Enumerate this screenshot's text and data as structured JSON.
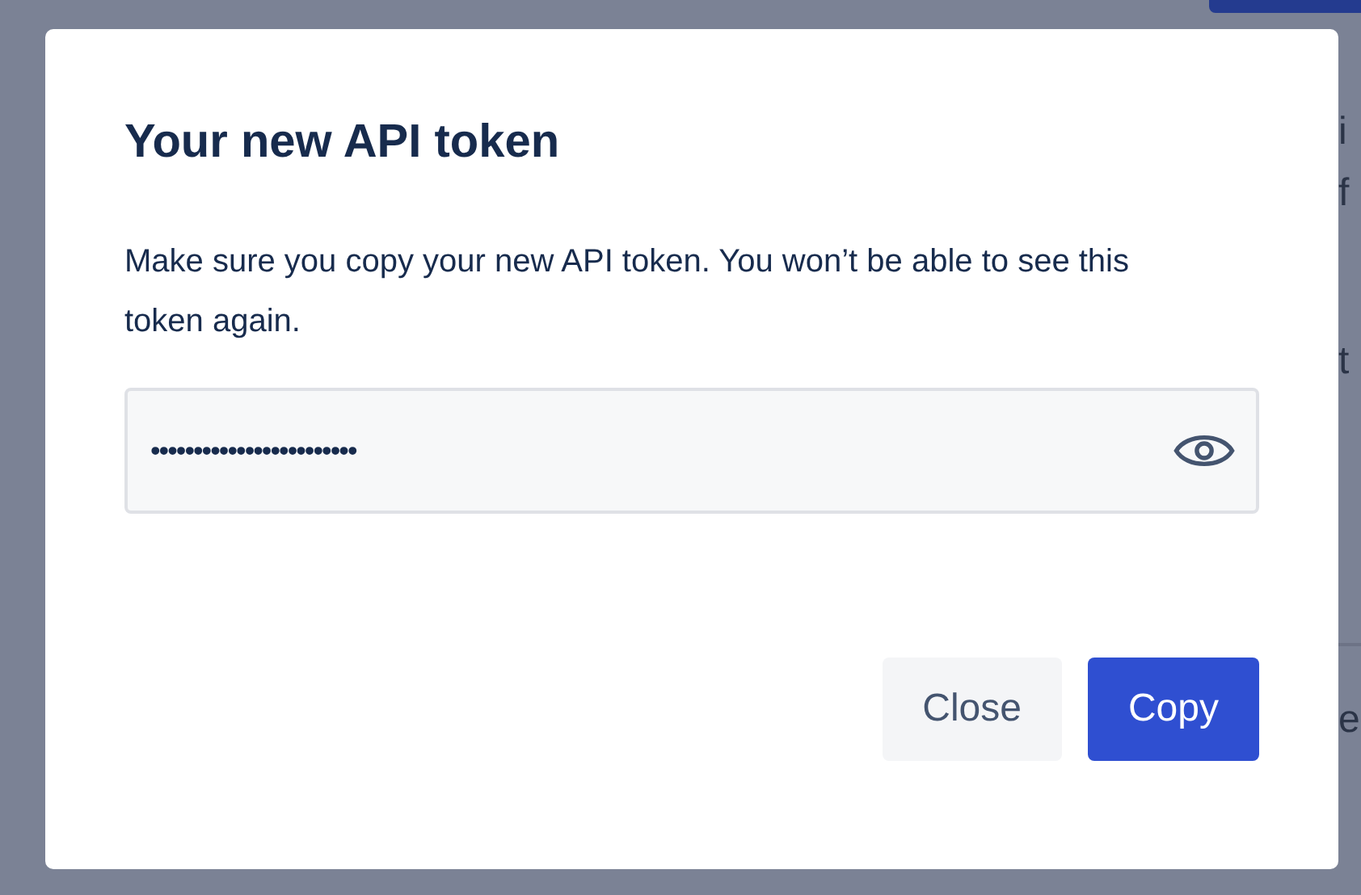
{
  "background": {
    "right_fragments": [
      "i",
      "f",
      "t",
      "e"
    ]
  },
  "dialog": {
    "title": "Your new API token",
    "message": "Make sure you copy your new API token. You won’t be able to see this token again.",
    "token_field": {
      "value": "••••••••••••••••••••••••"
    },
    "buttons": [
      {
        "label": "Close",
        "kind": "subtle"
      },
      {
        "label": "Copy",
        "kind": "primary"
      }
    ]
  }
}
